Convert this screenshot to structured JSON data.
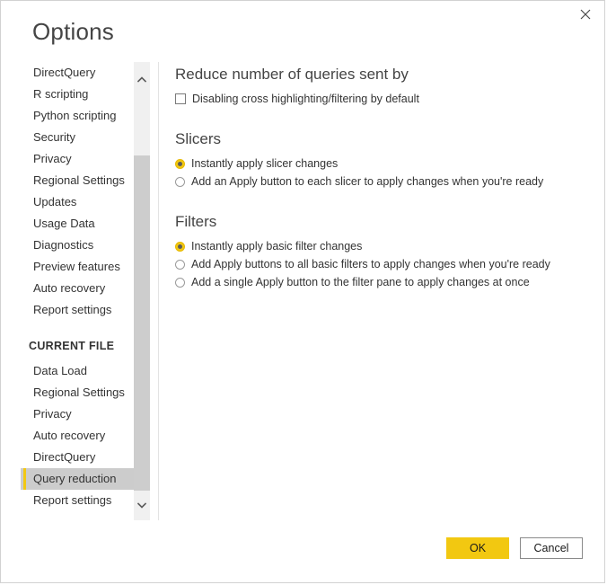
{
  "dialog": {
    "title": "Options",
    "close_icon": "close-icon"
  },
  "sidebar": {
    "global_items": [
      {
        "label": "DirectQuery"
      },
      {
        "label": "R scripting"
      },
      {
        "label": "Python scripting"
      },
      {
        "label": "Security"
      },
      {
        "label": "Privacy"
      },
      {
        "label": "Regional Settings"
      },
      {
        "label": "Updates"
      },
      {
        "label": "Usage Data"
      },
      {
        "label": "Diagnostics"
      },
      {
        "label": "Preview features"
      },
      {
        "label": "Auto recovery"
      },
      {
        "label": "Report settings"
      }
    ],
    "group_title": "CURRENT FILE",
    "current_file_items": [
      {
        "label": "Data Load",
        "selected": false
      },
      {
        "label": "Regional Settings",
        "selected": false
      },
      {
        "label": "Privacy",
        "selected": false
      },
      {
        "label": "Auto recovery",
        "selected": false
      },
      {
        "label": "DirectQuery",
        "selected": false
      },
      {
        "label": "Query reduction",
        "selected": true
      },
      {
        "label": "Report settings",
        "selected": false
      }
    ],
    "scrollbar": {
      "up_icon": "chevron-up-icon",
      "down_icon": "chevron-down-icon"
    },
    "selection_accent_color": "#f2c811",
    "selection_background_color": "#cccccc"
  },
  "content": {
    "reduce": {
      "heading": "Reduce number of queries sent by",
      "checkbox": {
        "label": "Disabling cross highlighting/filtering by default",
        "checked": false
      }
    },
    "slicers": {
      "heading": "Slicers",
      "options": [
        {
          "label": "Instantly apply slicer changes",
          "selected": true
        },
        {
          "label": "Add an Apply button to each slicer to apply changes when you're ready",
          "selected": false
        }
      ]
    },
    "filters": {
      "heading": "Filters",
      "options": [
        {
          "label": "Instantly apply basic filter changes",
          "selected": true
        },
        {
          "label": "Add Apply buttons to all basic filters to apply changes when you're ready",
          "selected": false
        },
        {
          "label": "Add a single Apply button to the filter pane to apply changes at once",
          "selected": false
        }
      ]
    }
  },
  "footer": {
    "ok_label": "OK",
    "cancel_label": "Cancel",
    "ok_color": "#f2c811"
  }
}
